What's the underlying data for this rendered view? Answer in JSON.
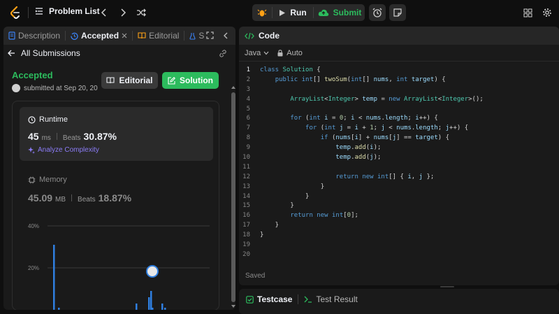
{
  "topbar": {
    "problem_list": "Problem List",
    "run": "Run",
    "submit": "Submit"
  },
  "left_tabs": {
    "description": "Description",
    "accepted": "Accepted",
    "editorial": "Editorial",
    "solutions_truncated": "S"
  },
  "submission": {
    "back": "All Submissions",
    "status": "Accepted",
    "submitted": "submitted at Sep 20, 20",
    "editorial_btn": "Editorial",
    "solution_btn": "Solution"
  },
  "runtime": {
    "title": "Runtime",
    "value": "45",
    "unit": "ms",
    "beats_label": "Beats",
    "beats": "30.87%",
    "analyze": "Analyze Complexity"
  },
  "memory": {
    "title": "Memory",
    "value": "45.09",
    "unit": "MB",
    "beats_label": "Beats",
    "beats": "18.87%"
  },
  "chart_data": {
    "type": "bar",
    "y_ticks": [
      "40%",
      "20%"
    ],
    "bars": [
      31,
      1,
      3,
      6,
      9,
      1,
      3,
      1
    ],
    "ylim": [
      0,
      40
    ],
    "grid": true
  },
  "code_panel": {
    "title": "Code",
    "language": "Java",
    "mode": "Auto",
    "saved": "Saved",
    "lines": [
      {
        "n": "1",
        "t": "class Solution {"
      },
      {
        "n": "2",
        "t": "    public int[] twoSum(int[] nums, int target) {"
      },
      {
        "n": "3",
        "t": ""
      },
      {
        "n": "4",
        "t": "        ArrayList<Integer> temp = new ArrayList<Integer>();"
      },
      {
        "n": "5",
        "t": ""
      },
      {
        "n": "6",
        "t": "        for (int i = 0; i < nums.length; i++) {"
      },
      {
        "n": "7",
        "t": "            for (int j = i + 1; j < nums.length; j++) {"
      },
      {
        "n": "8",
        "t": "                if (nums[i] + nums[j] == target) {"
      },
      {
        "n": "9",
        "t": "                    temp.add(i);"
      },
      {
        "n": "10",
        "t": "                    temp.add(j);"
      },
      {
        "n": "11",
        "t": ""
      },
      {
        "n": "12",
        "t": "                    return new int[] { i, j };"
      },
      {
        "n": "13",
        "t": "                }"
      },
      {
        "n": "14",
        "t": "            }"
      },
      {
        "n": "15",
        "t": "        }"
      },
      {
        "n": "16",
        "t": "        return new int[0];"
      },
      {
        "n": "17",
        "t": "    }"
      },
      {
        "n": "18",
        "t": "}"
      },
      {
        "n": "19",
        "t": ""
      },
      {
        "n": "20",
        "t": ""
      }
    ]
  },
  "bottom_tabs": {
    "testcase": "Testcase",
    "test_result": "Test Result"
  },
  "colors": {
    "accent_green": "#2cbb5d",
    "panel_bg": "#1a1a1a",
    "bar_blue": "#2f7fe0",
    "analyze_purple": "#8b7cf6"
  }
}
